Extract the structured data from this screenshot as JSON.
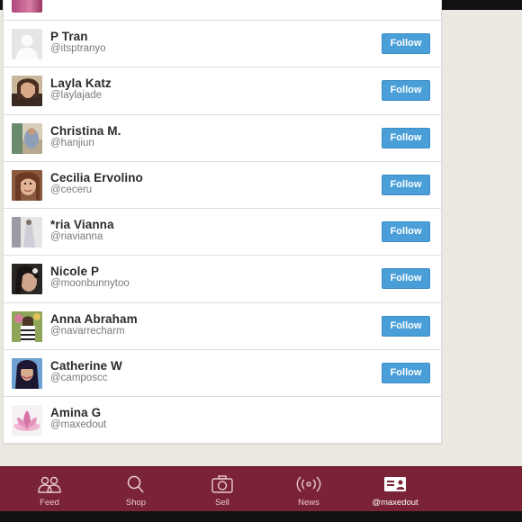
{
  "users": [
    {
      "name": "P Tran",
      "handle": "@itsptranyo",
      "follow_label": "Follow",
      "avatar": "default-silhouette"
    },
    {
      "name": "Layla Katz",
      "handle": "@laylajade",
      "follow_label": "Follow",
      "avatar": "photo"
    },
    {
      "name": "Christina M.",
      "handle": "@hanjiun",
      "follow_label": "Follow",
      "avatar": "photo"
    },
    {
      "name": "Cecilia Ervolino",
      "handle": "@ceceru",
      "follow_label": "Follow",
      "avatar": "photo"
    },
    {
      "name": "*ria Vianna",
      "handle": "@riavianna",
      "follow_label": "Follow",
      "avatar": "photo"
    },
    {
      "name": "Nicole P",
      "handle": "@moonbunnytoo",
      "follow_label": "Follow",
      "avatar": "photo"
    },
    {
      "name": "Anna Abraham",
      "handle": "@navarrecharm",
      "follow_label": "Follow",
      "avatar": "photo"
    },
    {
      "name": "Catherine W",
      "handle": "@camposcc",
      "follow_label": "Follow",
      "avatar": "photo"
    },
    {
      "name": "Amina G",
      "handle": "@maxedout",
      "avatar": "lotus-photo"
    }
  ],
  "tabs": [
    {
      "label": "Feed",
      "icon": "people-icon"
    },
    {
      "label": "Shop",
      "icon": "search-icon"
    },
    {
      "label": "Sell",
      "icon": "camera-icon"
    },
    {
      "label": "News",
      "icon": "broadcast-icon"
    },
    {
      "label": "@maxedout",
      "icon": "profile-card-icon",
      "active": true
    }
  ],
  "colors": {
    "follow_button": "#4a9fd8",
    "tab_bar": "#7a2236",
    "background": "#ece9e3"
  }
}
